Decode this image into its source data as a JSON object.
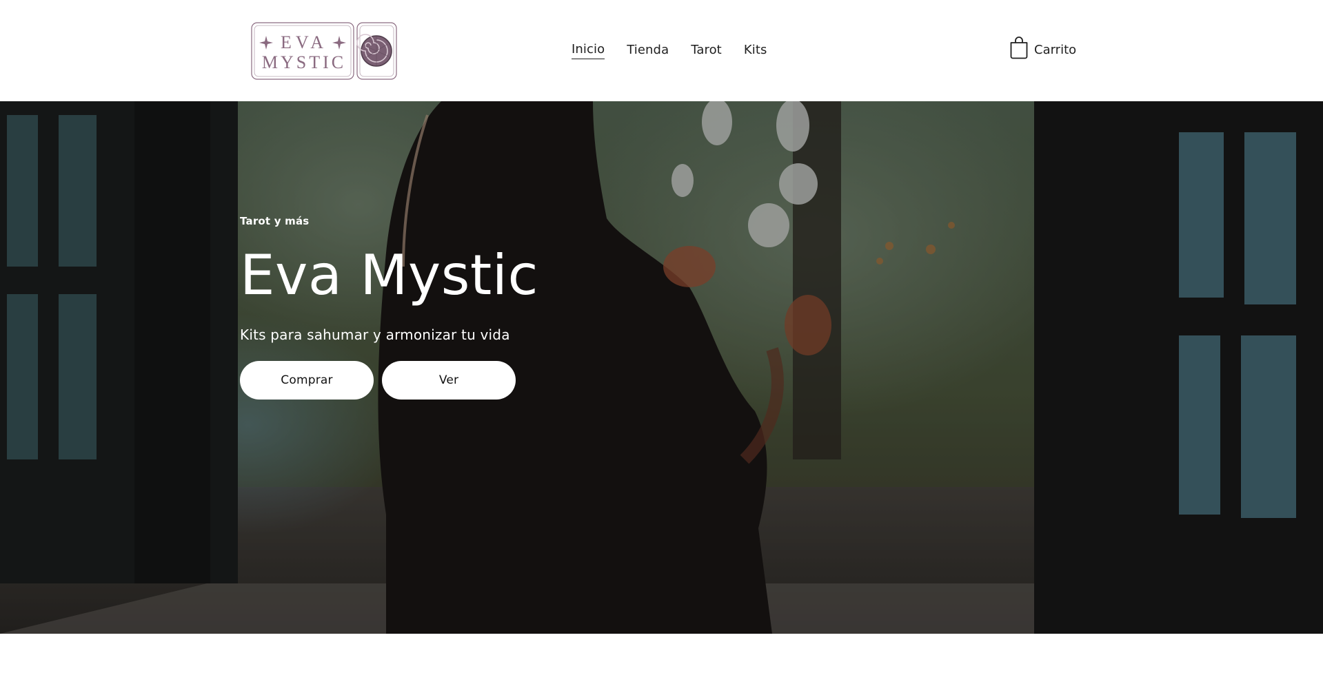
{
  "header": {
    "logo_text_top": "EVA",
    "logo_text_bottom": "MYSTIC",
    "nav": [
      {
        "label": "Inicio",
        "active": true
      },
      {
        "label": "Tienda",
        "active": false
      },
      {
        "label": "Tarot",
        "active": false
      },
      {
        "label": "Kits",
        "active": false
      }
    ],
    "cart_label": "Carrito"
  },
  "hero": {
    "eyebrow": "Tarot y más",
    "title": "Eva Mystic",
    "subtitle": "Kits para sahumar y armonizar tu vida",
    "buttons": {
      "primary": "Comprar",
      "secondary": "Ver"
    }
  },
  "colors": {
    "logo_accent": "#8a6a80",
    "overlay": "#000000",
    "button_bg": "#ffffff"
  },
  "icons": {
    "cart": "shopping-bag-icon",
    "logo_shell": "nautilus-shell-icon",
    "logo_star": "sparkle-star-icon"
  }
}
